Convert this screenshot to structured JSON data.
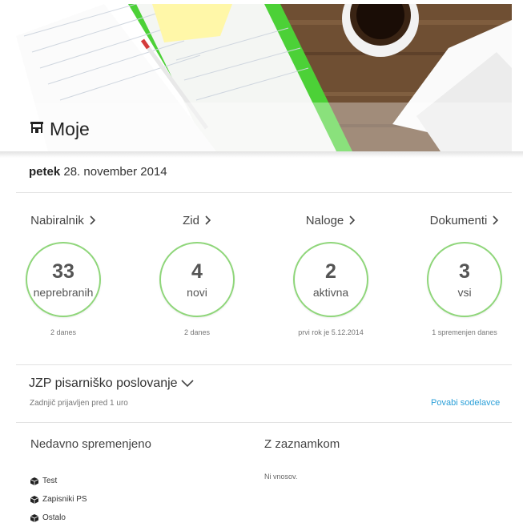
{
  "header": {
    "title": "Moje",
    "icon": "desk-chair-icon"
  },
  "date": {
    "weekday": "petek",
    "full": "28. november 2014"
  },
  "stats": [
    {
      "label": "Nabiralnik",
      "value": "33",
      "unit": "neprebranih",
      "sub": "2 danes"
    },
    {
      "label": "Zid",
      "value": "4",
      "unit": "novi",
      "sub": "2 danes"
    },
    {
      "label": "Naloge",
      "value": "2",
      "unit": "aktivna",
      "sub": "prvi rok je 5.12.2014"
    },
    {
      "label": "Dokumenti",
      "value": "3",
      "unit": "vsi",
      "sub": "1 spremenjen danes"
    }
  ],
  "project": {
    "title": "JZP pisarniško poslovanje",
    "last_login": "Zadnjič prijavljen pred 1 uro",
    "invite_label": "Povabi sodelavce"
  },
  "recent": {
    "title": "Nedavno spremenjeno",
    "items": [
      "Test",
      "Zapisniki PS",
      "Ostalo"
    ]
  },
  "bookmarks": {
    "title": "Z zaznamkom",
    "empty": "Ni vnosov."
  },
  "colors": {
    "accent": "#8fd67a",
    "link": "#2a9fd8",
    "brand_green": "#4cd137"
  }
}
